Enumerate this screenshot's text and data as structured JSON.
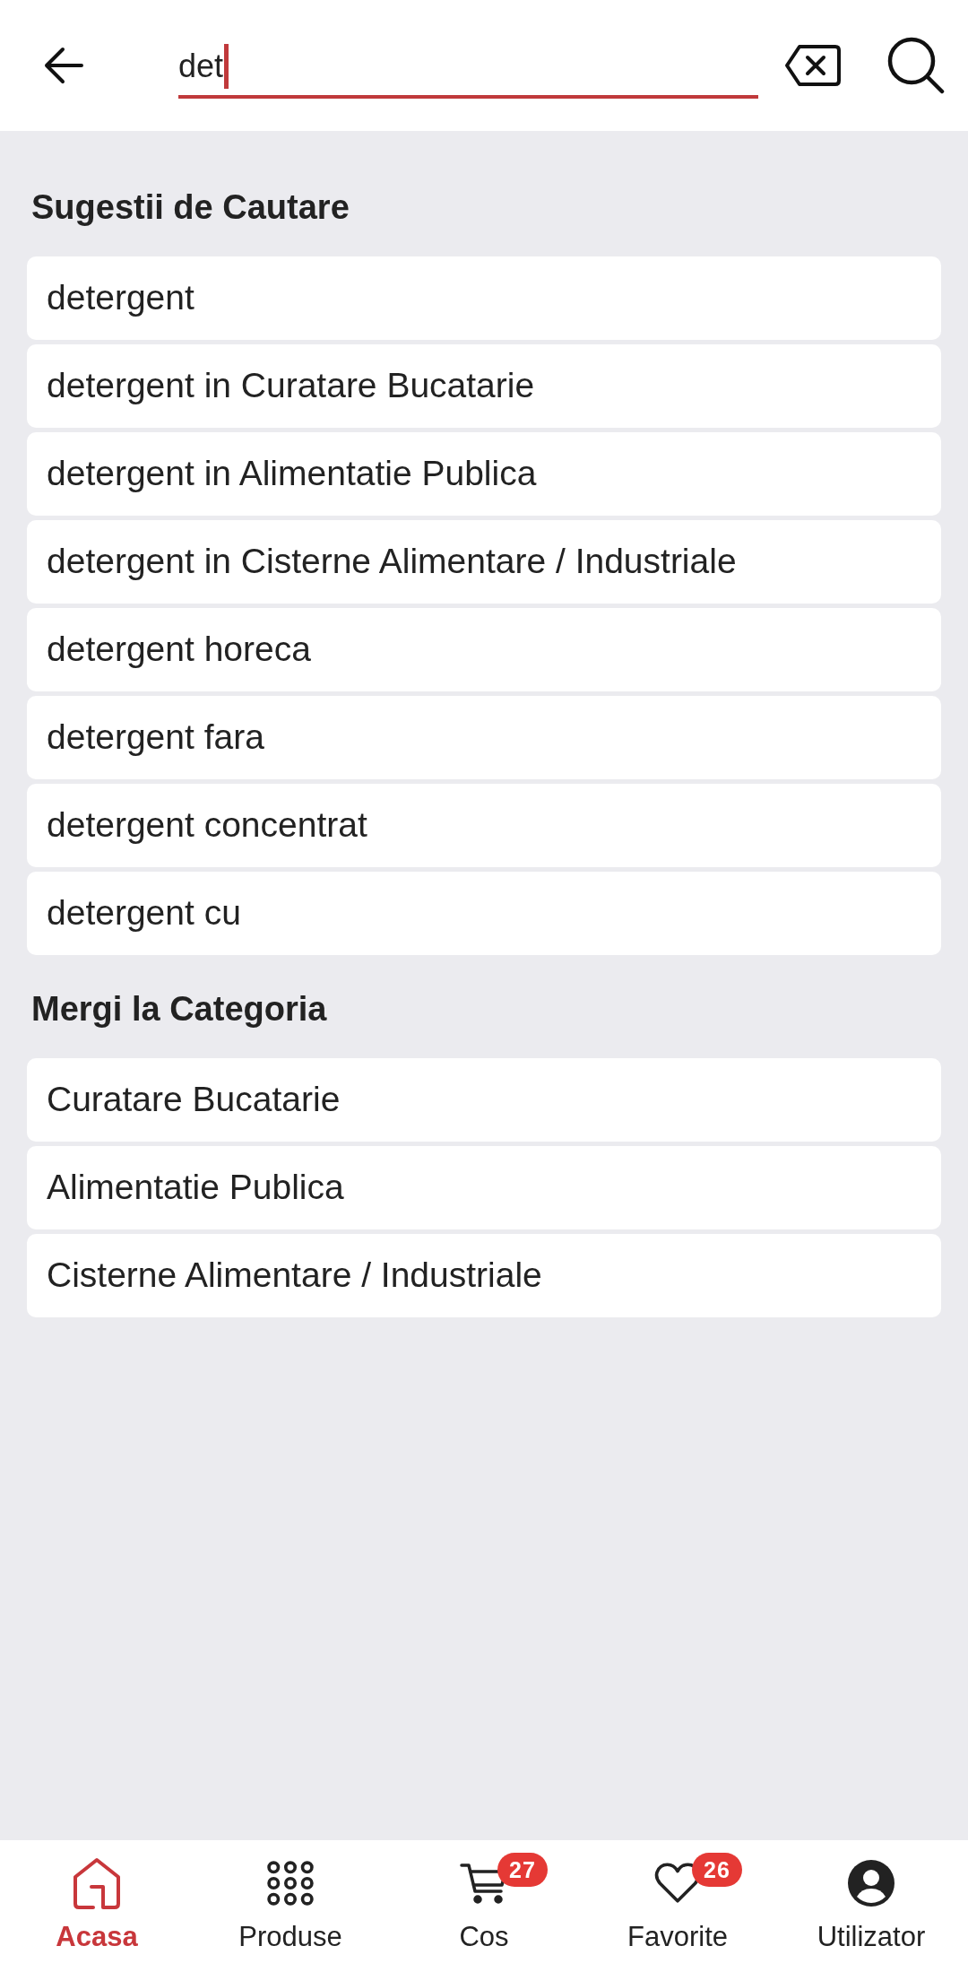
{
  "search": {
    "value": "det"
  },
  "suggestions": {
    "title": "Sugestii de Cautare",
    "items": [
      "detergent",
      "detergent in Curatare Bucatarie",
      "detergent in Alimentatie Publica",
      "detergent in Cisterne Alimentare / Industriale",
      "detergent horeca",
      "detergent fara",
      "detergent concentrat",
      "detergent cu"
    ]
  },
  "categories": {
    "title": "Mergi la Categoria",
    "items": [
      "Curatare Bucatarie",
      "Alimentatie Publica",
      "Cisterne Alimentare / Industriale"
    ]
  },
  "bottom_nav": [
    {
      "kind": "home",
      "label": "Acasa",
      "selected": true
    },
    {
      "kind": "products",
      "label": "Produse",
      "selected": false
    },
    {
      "kind": "cart",
      "label": "Cos",
      "selected": false,
      "badge": "27"
    },
    {
      "kind": "favorites",
      "label": "Favorite",
      "selected": false,
      "badge": "26"
    },
    {
      "kind": "user",
      "label": "Utilizator",
      "selected": false
    }
  ]
}
